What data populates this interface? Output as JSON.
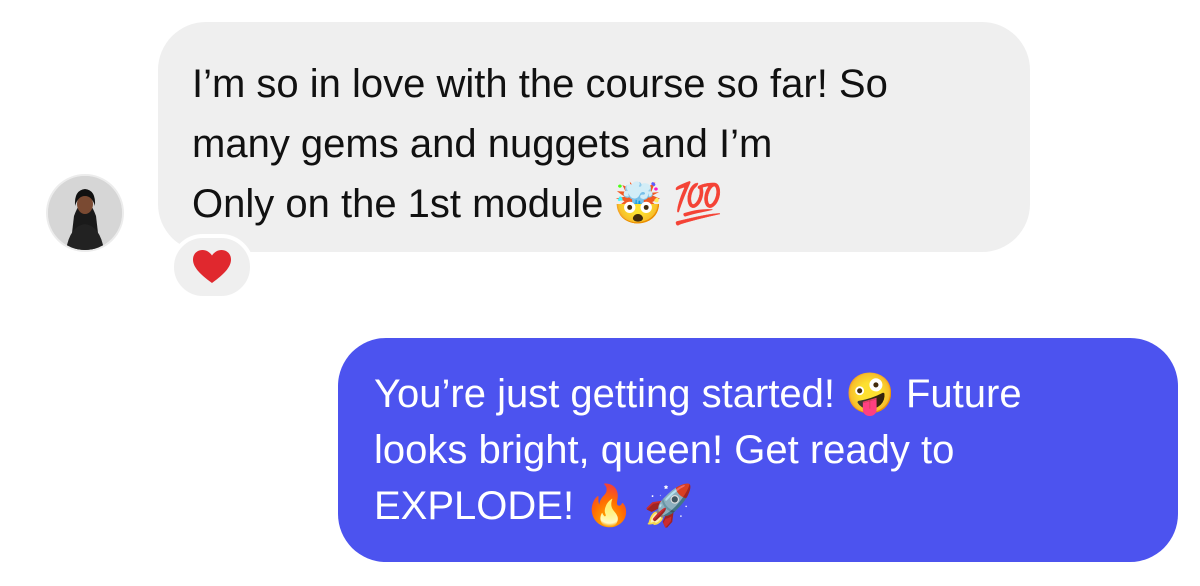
{
  "conversation": {
    "incoming": {
      "lines": [
        "I’m so in love with the course so far! So",
        "many gems and nuggets and I’m",
        "Only on the 1st module"
      ],
      "emojis": [
        "🤯",
        "💯"
      ],
      "reaction": "❤️"
    },
    "outgoing": {
      "lines": [
        "You’re just getting started!",
        "looks bright, queen! Get ready to",
        "EXPLODE!"
      ],
      "line1_emoji": "🤪",
      "line1_tail": "Future",
      "line3_emojis": [
        "🔥",
        "🚀"
      ]
    }
  },
  "colors": {
    "incoming_bubble": "#efefef",
    "outgoing_bubble": "#4c53ef",
    "heart": "#e0282e"
  },
  "icons": {
    "avatar": "user-avatar",
    "reaction": "heart-icon"
  }
}
